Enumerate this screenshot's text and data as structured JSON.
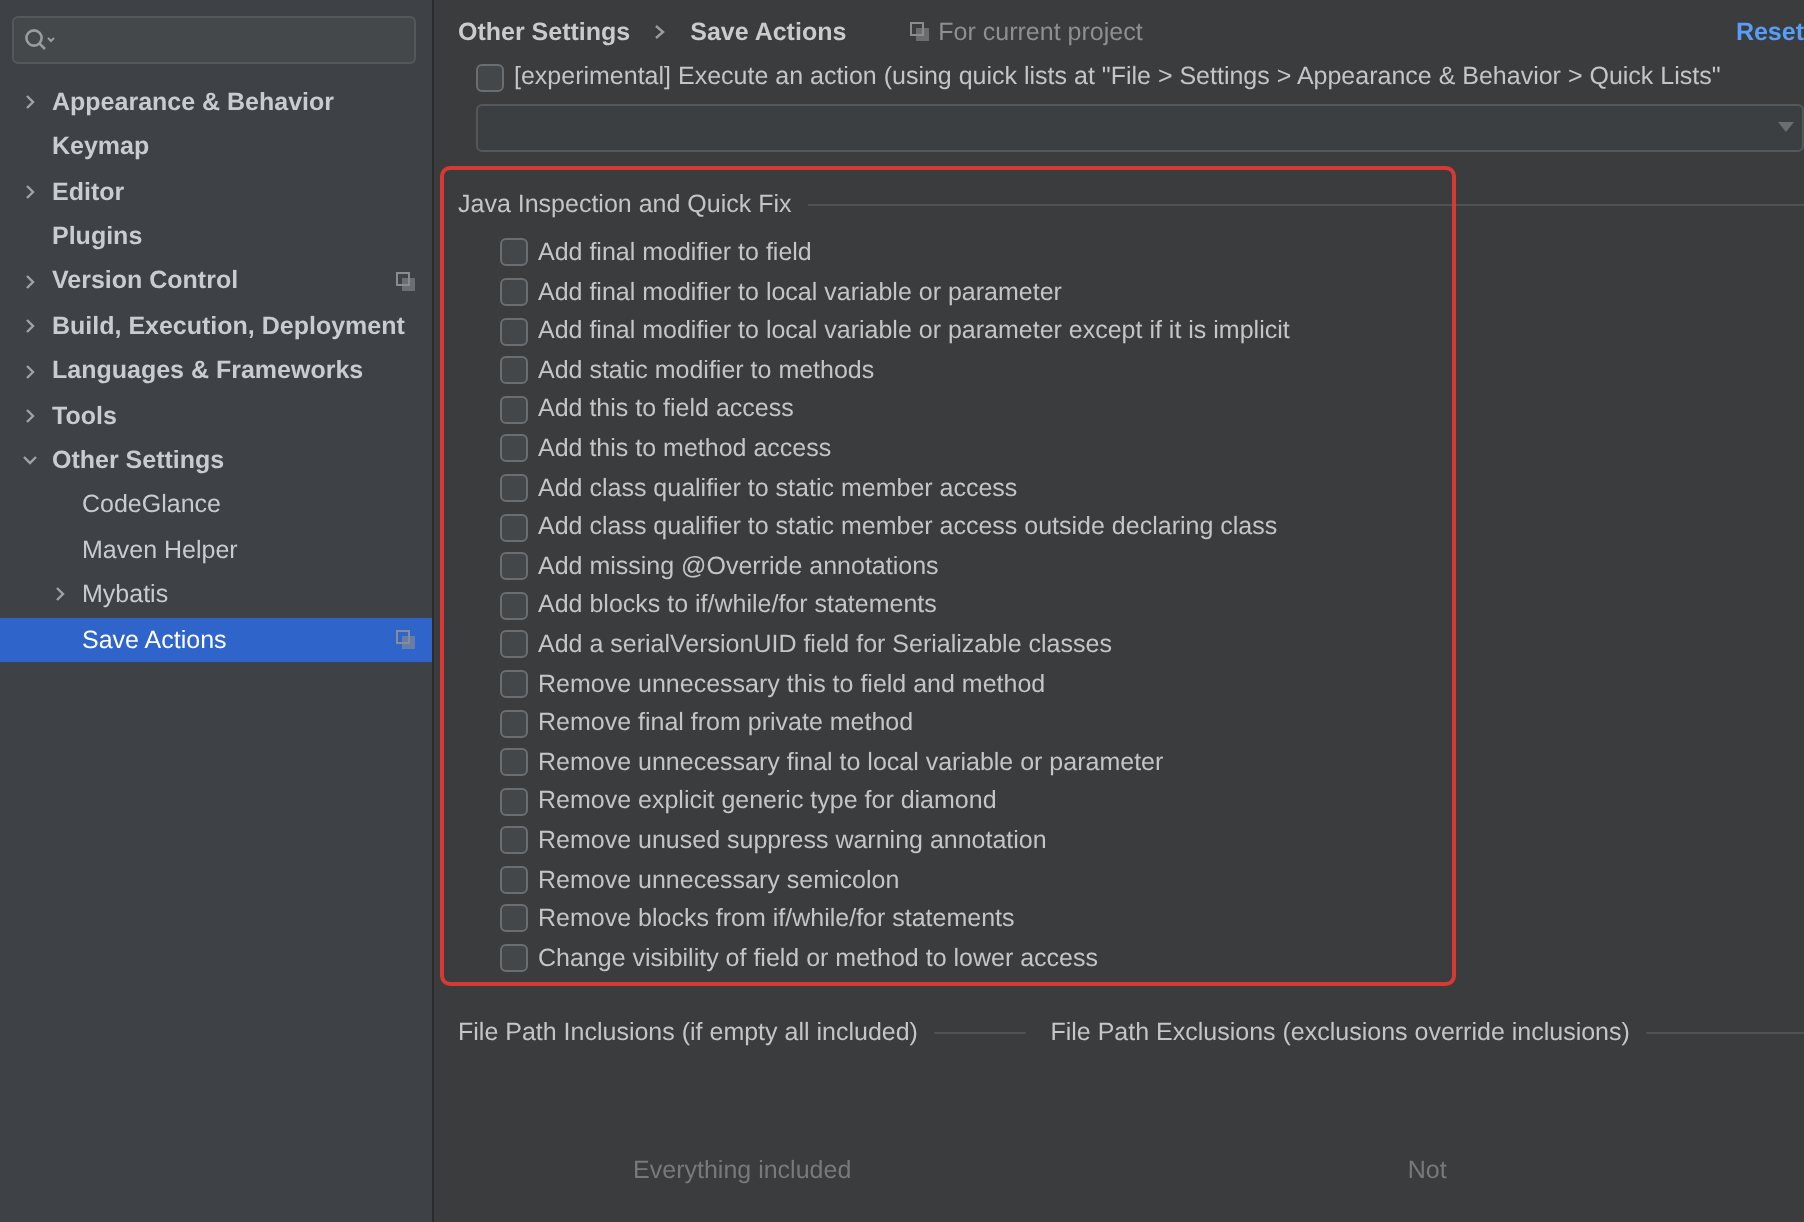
{
  "sidebar": {
    "items": [
      {
        "label": "Appearance & Behavior",
        "expandable": true,
        "expanded": false,
        "selected": false,
        "project_level": false
      },
      {
        "label": "Keymap",
        "expandable": false,
        "expanded": false,
        "selected": false,
        "project_level": false
      },
      {
        "label": "Editor",
        "expandable": true,
        "expanded": false,
        "selected": false,
        "project_level": false
      },
      {
        "label": "Plugins",
        "expandable": false,
        "expanded": false,
        "selected": false,
        "project_level": false
      },
      {
        "label": "Version Control",
        "expandable": true,
        "expanded": false,
        "selected": false,
        "project_level": true
      },
      {
        "label": "Build, Execution, Deployment",
        "expandable": true,
        "expanded": false,
        "selected": false,
        "project_level": false
      },
      {
        "label": "Languages & Frameworks",
        "expandable": true,
        "expanded": false,
        "selected": false,
        "project_level": false
      },
      {
        "label": "Tools",
        "expandable": true,
        "expanded": false,
        "selected": false,
        "project_level": false
      },
      {
        "label": "Other Settings",
        "expandable": true,
        "expanded": true,
        "selected": false,
        "project_level": false,
        "children": [
          {
            "label": "CodeGlance",
            "expandable": false,
            "expanded": false,
            "selected": false,
            "project_level": false
          },
          {
            "label": "Maven Helper",
            "expandable": false,
            "expanded": false,
            "selected": false,
            "project_level": false
          },
          {
            "label": "Mybatis",
            "expandable": true,
            "expanded": false,
            "selected": false,
            "project_level": false
          },
          {
            "label": "Save Actions",
            "expandable": false,
            "expanded": false,
            "selected": true,
            "project_level": true
          }
        ]
      }
    ]
  },
  "breadcrumb": [
    "Other Settings",
    "Save Actions"
  ],
  "scope_label": "For current project",
  "reset_link": "Reset",
  "experimental": {
    "label": "[experimental] Execute an action (using quick lists at \"File > Settings > Appearance & Behavior > Quick Lists\"",
    "checked": false
  },
  "java_inspection": {
    "title": "Java Inspection and Quick Fix",
    "options": [
      {
        "label": "Add final modifier to field",
        "checked": false
      },
      {
        "label": "Add final modifier to local variable or parameter",
        "checked": false
      },
      {
        "label": "Add final modifier to local variable or parameter except if it is implicit",
        "checked": false
      },
      {
        "label": "Add static modifier to methods",
        "checked": false
      },
      {
        "label": "Add this to field access",
        "checked": false
      },
      {
        "label": "Add this to method access",
        "checked": false
      },
      {
        "label": "Add class qualifier to static member access",
        "checked": false
      },
      {
        "label": "Add class qualifier to static member access outside declaring class",
        "checked": false
      },
      {
        "label": "Add missing @Override annotations",
        "checked": false
      },
      {
        "label": "Add blocks to if/while/for statements",
        "checked": false
      },
      {
        "label": "Add a serialVersionUID field for Serializable classes",
        "checked": false
      },
      {
        "label": "Remove unnecessary this to field and method",
        "checked": false
      },
      {
        "label": "Remove final from private method",
        "checked": false
      },
      {
        "label": "Remove unnecessary final to local variable or parameter",
        "checked": false
      },
      {
        "label": "Remove explicit generic type for diamond",
        "checked": false
      },
      {
        "label": "Remove unused suppress warning annotation",
        "checked": false
      },
      {
        "label": "Remove unnecessary semicolon",
        "checked": false
      },
      {
        "label": "Remove blocks from if/while/for statements",
        "checked": false
      },
      {
        "label": "Change visibility of field or method to lower access",
        "checked": false
      }
    ]
  },
  "inclusions": {
    "title": "File Path Inclusions (if empty all included)",
    "empty_text": "Everything included"
  },
  "exclusions": {
    "title": "File Path Exclusions (exclusions override inclusions)",
    "empty_text": "Not"
  }
}
